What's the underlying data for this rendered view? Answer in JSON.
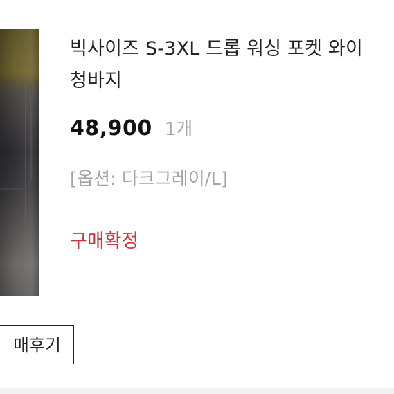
{
  "product": {
    "title_line1": "빅사이즈 S-3XL 드롭 워싱 포켓 와이",
    "title_line2": "청바지",
    "price": "48,900",
    "quantity": "1개",
    "option": "[옵션: 다크그레이/L]",
    "status": "구매확정"
  },
  "actions": {
    "review_button": "매후기"
  },
  "colors": {
    "status": "#c8383c",
    "muted": "#a4a4a4",
    "text": "#222222"
  }
}
